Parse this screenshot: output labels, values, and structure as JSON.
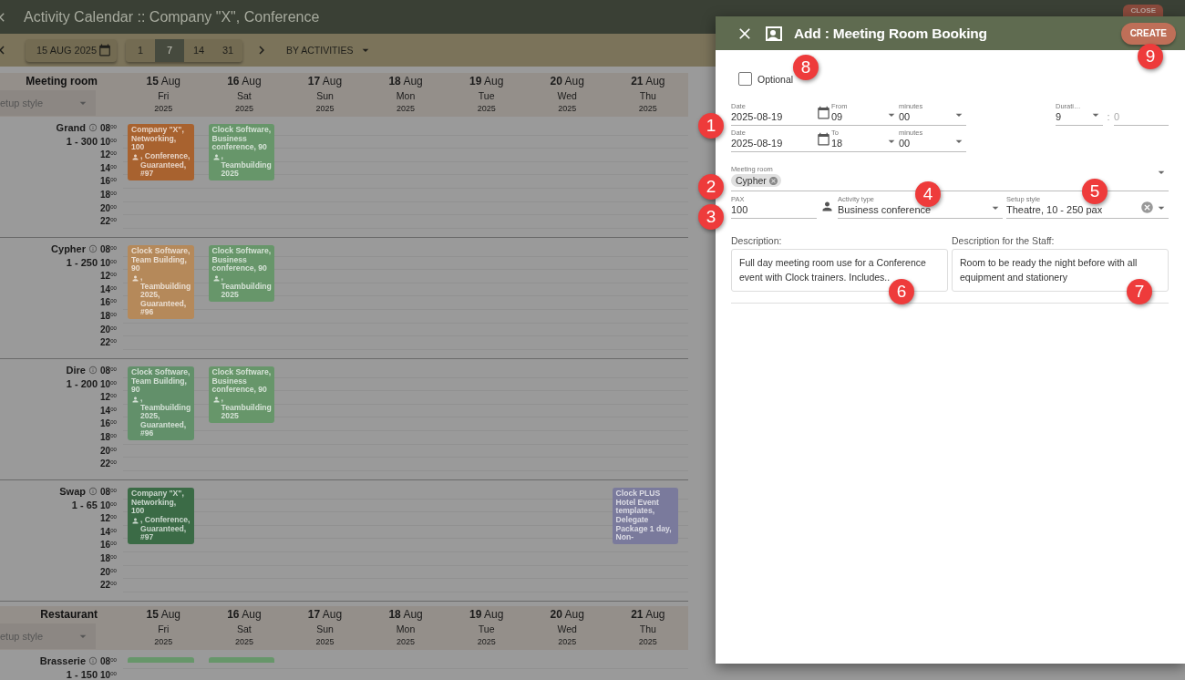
{
  "app_bar": {
    "title": "Activity Calendar :: Company \"X\", Conference",
    "close_button": "CLOSE"
  },
  "toolbar": {
    "date": "15 AUG 2025",
    "ranges": [
      {
        "label": "1",
        "selected": false
      },
      {
        "label": "7",
        "selected": true
      },
      {
        "label": "14",
        "selected": false
      },
      {
        "label": "31",
        "selected": false
      }
    ],
    "view": "BY ACTIVITIES"
  },
  "calendar_sections": [
    {
      "group": "Meeting room",
      "setup_placeholder": "etup style",
      "days": [
        {
          "date": "**15** Aug",
          "weekday": "Fri",
          "year": "2025"
        },
        {
          "date": "**16** Aug",
          "weekday": "Sat",
          "year": "2025"
        },
        {
          "date": "**17** Aug",
          "weekday": "Sun",
          "year": "2025"
        },
        {
          "date": "**18** Aug",
          "weekday": "Mon",
          "year": "2025"
        },
        {
          "date": "**19** Aug",
          "weekday": "Tue",
          "year": "2025"
        },
        {
          "date": "**20** Aug",
          "weekday": "Wed",
          "year": "2025"
        },
        {
          "date": "**21** Aug",
          "weekday": "Thu",
          "year": "2025"
        }
      ],
      "rooms": [
        {
          "name": "Grand",
          "capacity": "1 - 300",
          "hours": [
            "08$^{00}$",
            "10$^{00}$",
            "12$^{00}$",
            "14$^{00}$",
            "16$^{00}$",
            "18$^{00}$",
            "20$^{00}$",
            "22$^{00}$"
          ],
          "slots": [
            {
              "kind": "event",
              "color": "#a8622f",
              "text": "Company \"X\", Networking, 100",
              "text_after": ", Conference, Guaranteed, #97"
            },
            {
              "kind": "event",
              "color": "#67966a",
              "text": "Clock Software, Business conference, 90",
              "text_after": ", Teambuilding 2025"
            },
            {
              "kind": "empty"
            },
            {
              "kind": "empty"
            },
            {
              "kind": "empty"
            },
            {
              "kind": "empty"
            },
            {
              "kind": "empty"
            }
          ]
        },
        {
          "name": "Cypher",
          "capacity": "1 - 250",
          "hours": [
            "08$^{00}$",
            "10$^{00}$",
            "12$^{00}$",
            "14$^{00}$",
            "16$^{00}$",
            "18$^{00}$",
            "20$^{00}$",
            "22$^{00}$"
          ],
          "slots": [
            {
              "kind": "event",
              "color": "#b5895a",
              "text": "Clock Software, Team Building, 90",
              "text_after": ", Teambuilding 2025, Guaranteed, #96"
            },
            {
              "kind": "event",
              "color": "#67966a",
              "text": "Clock Software, Business conference, 90",
              "text_after": ", Teambuilding 2025"
            },
            {
              "kind": "empty"
            },
            {
              "kind": "empty"
            },
            {
              "kind": "empty"
            },
            {
              "kind": "empty"
            },
            {
              "kind": "empty"
            }
          ]
        },
        {
          "name": "Dire",
          "capacity": "1 - 200",
          "hours": [
            "08$^{00}$",
            "10$^{00}$",
            "12$^{00}$",
            "14$^{00}$",
            "16$^{00}$",
            "18$^{00}$",
            "20$^{00}$",
            "22$^{00}$"
          ],
          "slots": [
            {
              "kind": "event",
              "color": "#62906a",
              "text": "Clock Software, Team Building, 90",
              "text_after": ", Teambuilding 2025, Guaranteed, #96"
            },
            {
              "kind": "event",
              "color": "#67966a",
              "text": "Clock Software, Business conference, 90",
              "text_after": ", Teambuilding 2025"
            },
            {
              "kind": "empty"
            },
            {
              "kind": "empty"
            },
            {
              "kind": "empty"
            },
            {
              "kind": "empty"
            },
            {
              "kind": "empty"
            }
          ]
        },
        {
          "name": "Swap",
          "capacity": "1 - 65",
          "hours": [
            "08$^{00}$",
            "10$^{00}$",
            "12$^{00}$",
            "14$^{00}$",
            "16$^{00}$",
            "18$^{00}$",
            "20$^{00}$",
            "22$^{00}$"
          ],
          "slots": [
            {
              "kind": "event",
              "color": "#3b6b46",
              "text": "Company \"X\", Networking, 100",
              "text_after": ", Conference, Guaranteed, #97"
            },
            {
              "kind": "empty"
            },
            {
              "kind": "empty"
            },
            {
              "kind": "empty"
            },
            {
              "kind": "empty"
            },
            {
              "kind": "empty"
            },
            {
              "kind": "event",
              "color": "#7a7a9c",
              "text": "Clock PLUS Hotel Event templates, Delegate Package 1 day, Non-"
            }
          ]
        }
      ]
    },
    {
      "group": "Restaurant",
      "setup_placeholder": "etup style",
      "days": [
        {
          "date": "**15** Aug",
          "weekday": "Fri",
          "year": "2025"
        },
        {
          "date": "**16** Aug",
          "weekday": "Sat",
          "year": "2025"
        },
        {
          "date": "**17** Aug",
          "weekday": "Sun",
          "year": "2025"
        },
        {
          "date": "**18** Aug",
          "weekday": "Mon",
          "year": "2025"
        },
        {
          "date": "**19** Aug",
          "weekday": "Tue",
          "year": "2025"
        },
        {
          "date": "**20** Aug",
          "weekday": "Wed",
          "year": "2025"
        },
        {
          "date": "**21** Aug",
          "weekday": "Thu",
          "year": "2025"
        }
      ],
      "rooms": [
        {
          "name": "Brasserie",
          "capacity": "1 - 150",
          "hours": [
            "08$^{00}$",
            "10$^{00}$"
          ],
          "slots": [
            {
              "kind": "event",
              "color": "#67966a"
            },
            {
              "kind": "event",
              "color": "#67966a"
            },
            {
              "kind": "empty"
            },
            {
              "kind": "empty"
            },
            {
              "kind": "empty"
            },
            {
              "kind": "empty"
            },
            {
              "kind": "empty"
            }
          ]
        }
      ]
    }
  ],
  "dialog": {
    "title": "Add : Meeting Room Booking",
    "create_button": "CREATE",
    "optional": {
      "label": "Optional",
      "checked": false
    },
    "time_rows": [
      {
        "date_label": "Date",
        "date": "2025-08-19",
        "hour_label": "From",
        "hour": "09",
        "minutes_label": "minutes",
        "minutes": "00",
        "duration": {
          "label": "Durati…",
          "hours": "9",
          "separator": ":",
          "minutes": "0"
        }
      },
      {
        "date_label": "Date",
        "date": "2025-08-19",
        "hour_label": "To",
        "hour": "18",
        "minutes_label": "minutes",
        "minutes": "00"
      }
    ],
    "meeting_room": {
      "label": "Meeting room",
      "chips": [
        "Cypher"
      ]
    },
    "pax": {
      "label": "PAX",
      "value": "100"
    },
    "activity_type": {
      "label": "Activity type",
      "value": "Business conference"
    },
    "setup_style": {
      "label": "Setup style",
      "value": "Theatre, 10 - 250 pax"
    },
    "descriptions": [
      {
        "label": "Description:",
        "value": "Full day meeting room use for a Conference event with Clock trainers. Includes.."
      },
      {
        "label": "Description for the Staff:",
        "value": "Room to be ready the night before with all equipment and stationery"
      }
    ]
  },
  "markers": [
    "1",
    "2",
    "3",
    "4",
    "5",
    "6",
    "7",
    "8",
    "9"
  ]
}
